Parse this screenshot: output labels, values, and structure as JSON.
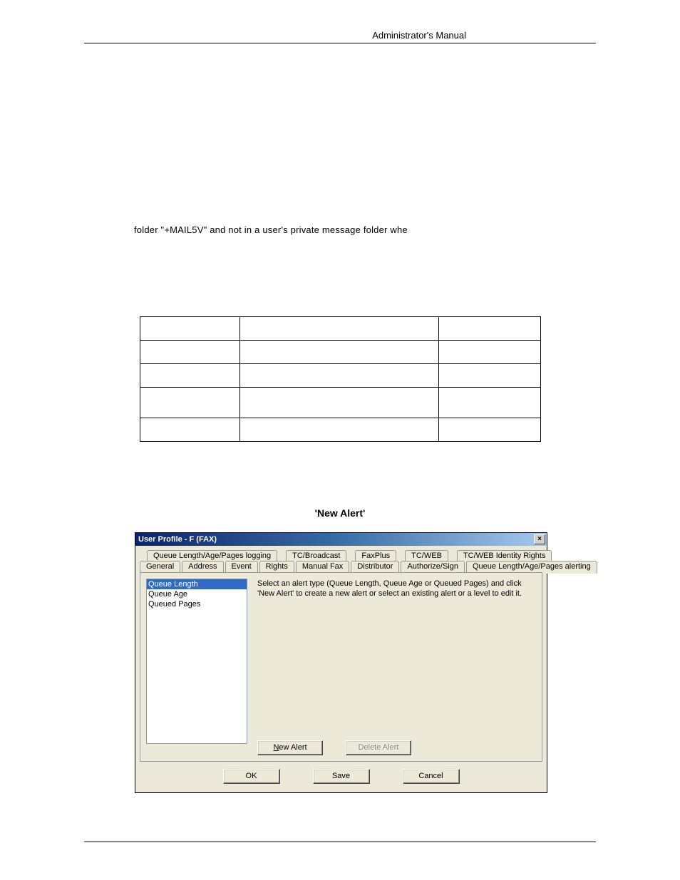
{
  "header": {
    "right": "Administrator's Manual"
  },
  "body_text": "folder \"+MAIL5V\" and not in a user's private message folder whe",
  "section_title": "'New Alert'",
  "dialog": {
    "title": "User Profile - F (FAX)",
    "close_glyph": "×",
    "tabs_row1": [
      "Queue Length/Age/Pages logging",
      "TC/Broadcast",
      "FaxPlus",
      "TC/WEB",
      "TC/WEB Identity Rights"
    ],
    "tabs_row2": [
      "General",
      "Address",
      "Event",
      "Rights",
      "Manual Fax",
      "Distributor",
      "Authorize/Sign",
      "Queue Length/Age/Pages alerting"
    ],
    "list": {
      "items": [
        "Queue Length",
        "Queue Age",
        "Queued Pages"
      ],
      "selected_index": 0
    },
    "description": "Select an alert type (Queue Length, Queue Age or Queued Pages) and click 'New Alert' to create a new alert or select an existing alert or a level to edit it.",
    "panel_buttons": {
      "new_alert_accel": "N",
      "new_alert_rest": "ew Alert",
      "delete_alert": "Delete Alert"
    },
    "buttons": {
      "ok": "OK",
      "save": "Save",
      "cancel": "Cancel"
    }
  }
}
